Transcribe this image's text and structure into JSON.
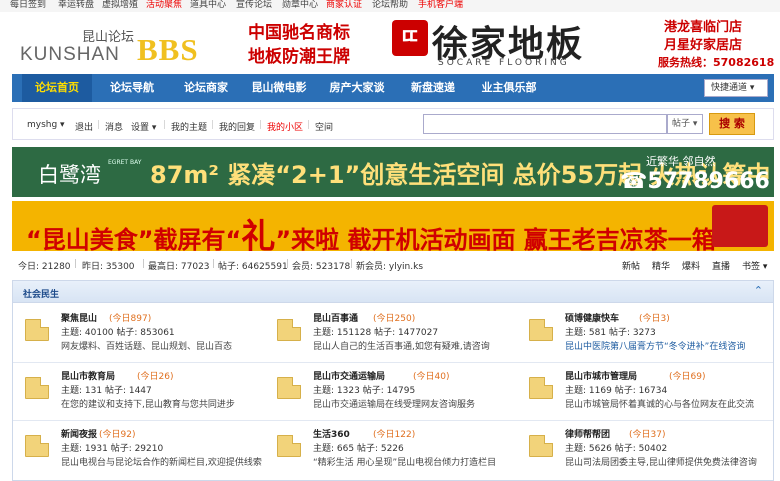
{
  "topbar": {
    "items": [
      {
        "label": "每日签到",
        "color": "#444444"
      },
      {
        "label": "幸运转盘",
        "color": "#444444"
      },
      {
        "label": "虚拟增殖",
        "color": "#444444"
      },
      {
        "label": "活动聚焦",
        "color": "#ee0000"
      },
      {
        "label": "道具中心",
        "color": "#444444"
      },
      {
        "label": "宣传论坛",
        "color": "#444444"
      },
      {
        "label": "勋章中心",
        "color": "#444444"
      },
      {
        "label": "商家认证",
        "color": "#ee0000"
      },
      {
        "label": "论坛帮助",
        "color": "#444444"
      },
      {
        "label": "手机客户端",
        "color": "#ee0000"
      }
    ]
  },
  "logo": {
    "cn": "昆山论坛",
    "en": "KUNSHAN",
    "bbs": "BBS"
  },
  "banner_top": {
    "line1": "中国驰名商标",
    "line2": "地板防潮王牌",
    "logo_mark": "ㄸ",
    "brand": "徐家地板",
    "brand_en": "SOCARE FLOORING",
    "right1": "港龙喜临门店",
    "right2": "月星好家居店",
    "hotline": "服务热线：57082618"
  },
  "nav": {
    "items": [
      {
        "label": "论坛首页",
        "active": true
      },
      {
        "label": "论坛导航",
        "active": false
      },
      {
        "label": "论坛商家",
        "active": false
      },
      {
        "label": "昆山微电影",
        "active": false
      },
      {
        "label": "房产大家谈",
        "active": false
      },
      {
        "label": "新盘速递",
        "active": false
      },
      {
        "label": "业主俱乐部",
        "active": false
      }
    ],
    "quick_label": "快捷通道 ▾"
  },
  "userbar": {
    "username": "myshg ▾",
    "exit": "退出",
    "message": "消息",
    "settings": "设置 ▾",
    "my_topics": "我的主题",
    "my_replies": "我的回复",
    "my_area": "我的小区",
    "space": "空间",
    "search_placeholder": "",
    "search_type": "帖子 ▾",
    "search_button": "搜 索"
  },
  "ad1": {
    "logo": "白鹭湾",
    "logo_en": "EGRET BAY",
    "main": "87m² 紧凑“2+1”创意生活空间 总价55万起 火热认筹中",
    "name": "近繁华 邻自然",
    "tel": "☎57789666"
  },
  "ad2": {
    "part1": "“昆山美食”截屏有“",
    "big": "礼",
    "part2": "”来啦  截开机活动画面  赢王老吉凉茶一箱"
  },
  "stats": {
    "today": "今日: 21280",
    "yesterday": "昨日: 35300",
    "max": "最高日: 77023",
    "posts": "帖子: 64625591",
    "members": "会员: 523178",
    "newest": "新会员: ylyin.ks",
    "right": [
      "新帖",
      "精华",
      "爆料",
      "直播",
      "书签 ▾"
    ]
  },
  "section": {
    "title": "社会民生",
    "collapse": "⌃",
    "forums": [
      {
        "name": "聚焦昆山",
        "today": "(今日897)",
        "topics": "主题: 40100",
        "posts": "帖子: 853061",
        "desc": "网友爆料、百姓话题、昆山规划、昆山百态",
        "desc_color": "#444444"
      },
      {
        "name": "昆山百事通",
        "today": "(今日250)",
        "topics": "主题: 151128",
        "posts": "帖子: 1477027",
        "desc": "昆山人自己的生活百事通,如您有疑难,请咨询",
        "desc_color": "#444444"
      },
      {
        "name": "硕博健康快车",
        "today": "(今日3)",
        "topics": "主题: 581",
        "posts": "帖子: 3273",
        "desc": "昆山中医院第八届膏方节“冬令进补”在线咨询",
        "desc_color": "#1d5ba0"
      },
      {
        "name": "昆山市教育局",
        "today": "(今日26)",
        "topics": "主题: 131",
        "posts": "帖子: 1447",
        "desc": "在您的建议和支持下,昆山教育与您共同进步",
        "desc_color": "#444444"
      },
      {
        "name": "昆山市交通运输局",
        "today": "(今日40)",
        "topics": "主题: 1323",
        "posts": "帖子: 14795",
        "desc": "昆山市交通运输局在线受理网友咨询服务",
        "desc_color": "#444444"
      },
      {
        "name": "昆山市城市管理局",
        "today": "(今日69)",
        "topics": "主题: 1169",
        "posts": "帖子: 16734",
        "desc": "昆山市城管局怀着真诚的心与各位网友在此交流",
        "desc_color": "#444444"
      },
      {
        "name": "新闻夜报",
        "today": "(今日92)",
        "topics": "主题: 1931",
        "posts": "帖子: 29210",
        "desc": "昆山电视台与昆论坛合作的新闻栏目,欢迎提供线索",
        "desc_color": "#444444"
      },
      {
        "name": "生活360",
        "today": "(今日122)",
        "topics": "主题: 665",
        "posts": "帖子: 5226",
        "desc": "“精彩生活 用心呈现”昆山电视台倾力打造栏目",
        "desc_color": "#444444"
      },
      {
        "name": "律师帮帮团",
        "today": "(今日37)",
        "topics": "主题: 5626",
        "posts": "帖子: 50402",
        "desc": "昆山司法局团委主导,昆山律师提供免费法律咨询",
        "desc_color": "#444444"
      }
    ]
  }
}
